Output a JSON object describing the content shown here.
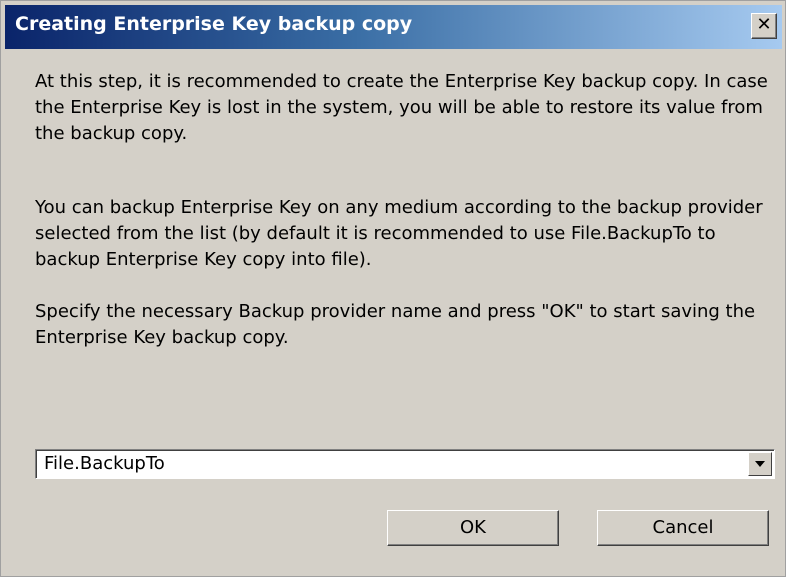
{
  "window": {
    "title": "Creating Enterprise Key backup copy",
    "close_glyph": "✕",
    "close_icon": "close-icon",
    "titlebar_color_start": "#0a246a",
    "titlebar_color_end": "#a6caf0",
    "background_color": "#d4d0c8"
  },
  "body": {
    "paragraph1": "At this step, it is recommended to create the Enterprise Key backup copy. In case the Enterprise Key is lost in the system, you will be able to restore its value from the backup copy.",
    "paragraph2": "You can backup Enterprise Key on any medium according to the backup provider selected from the list (by default it is recommended to use File.BackupTo to backup Enterprise Key copy into file).",
    "paragraph3": "Specify the necessary Backup provider name and press \"OK\" to start saving the Enterprise Key backup copy."
  },
  "provider_select": {
    "value": "File.BackupTo",
    "arrow_icon": "dropdown-arrow-icon"
  },
  "buttons": {
    "ok_label": "OK",
    "cancel_label": "Cancel"
  }
}
